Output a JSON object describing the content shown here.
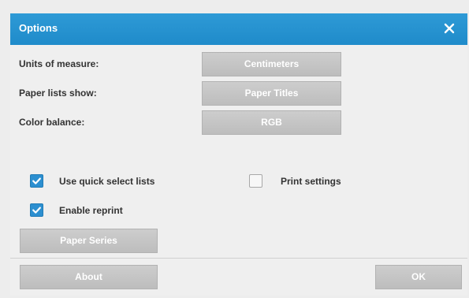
{
  "dialog": {
    "title": "Options",
    "close_icon": "close-icon"
  },
  "settings": [
    {
      "label": "Units of measure:",
      "value": "Centimeters"
    },
    {
      "label": "Paper lists show:",
      "value": "Paper Titles"
    },
    {
      "label": "Color balance:",
      "value": "RGB"
    }
  ],
  "checkboxes": {
    "quick_select": {
      "label": "Use quick select lists",
      "checked": true
    },
    "reprint": {
      "label": "Enable reprint",
      "checked": true
    },
    "print_settings": {
      "label": "Print settings",
      "checked": false
    }
  },
  "buttons": {
    "paper_series": "Paper Series",
    "about": "About",
    "ok": "OK"
  },
  "colors": {
    "titlebar": "#1f8bca",
    "checkbox_checked": "#2c8fd0",
    "button": "#c6c6c6"
  }
}
